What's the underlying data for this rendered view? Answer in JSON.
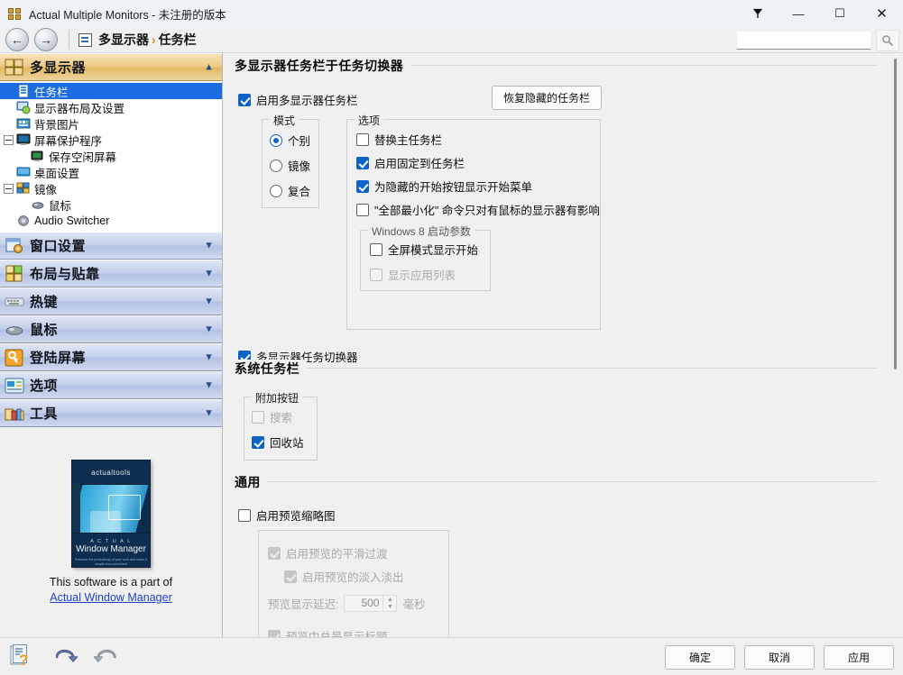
{
  "window": {
    "title": "Actual Multiple Monitors - 未注册的版本",
    "icon": "app-grid-icon",
    "pin_label": "📌",
    "minimize_label": "—",
    "maximize_label": "☐",
    "close_label": "✕"
  },
  "navbar": {
    "back_label": "←",
    "forward_label": "→",
    "breadcrumb_root": "多显示器",
    "breadcrumb_sep": "›",
    "breadcrumb_current": "任务栏",
    "search_value": "",
    "search_placeholder": "",
    "search_button_icon": "magnifier-icon"
  },
  "sidebar": {
    "sections": [
      {
        "label": "多显示器",
        "state": "expanded",
        "chevron": "chevron-up-icon",
        "items": [
          {
            "label": "任务栏",
            "selected": true,
            "expander": "none",
            "indent": 18,
            "icon": "taskbar-icon"
          },
          {
            "label": "显示器布局及设置",
            "selected": false,
            "expander": "none",
            "indent": 18,
            "icon": "monitor-layout-icon"
          },
          {
            "label": "背景图片",
            "selected": false,
            "expander": "none",
            "indent": 18,
            "icon": "wallpaper-icon"
          },
          {
            "label": "屏幕保护程序",
            "selected": false,
            "expander": "minus",
            "indent": 4,
            "icon": "screensaver-icon"
          },
          {
            "label": "保存空闲屏幕",
            "selected": false,
            "expander": "none",
            "indent": 34,
            "icon": "idle-screen-icon"
          },
          {
            "label": "桌面设置",
            "selected": false,
            "expander": "none",
            "indent": 18,
            "icon": "desktop-icon"
          },
          {
            "label": "镜像",
            "selected": false,
            "expander": "minus",
            "indent": 4,
            "icon": "mirror-icon"
          },
          {
            "label": "鼠标",
            "selected": false,
            "expander": "none",
            "indent": 34,
            "icon": "mouse-icon"
          },
          {
            "label": "Audio Switcher",
            "selected": false,
            "expander": "none",
            "indent": 18,
            "icon": "speaker-icon"
          }
        ]
      },
      {
        "label": "窗口设置",
        "state": "collapsed",
        "chevron": "chevron-down-icon",
        "icon": "window-settings-icon"
      },
      {
        "label": "布局与贴靠",
        "state": "collapsed",
        "chevron": "chevron-down-icon",
        "icon": "layout-snap-icon"
      },
      {
        "label": "热键",
        "state": "collapsed",
        "chevron": "chevron-down-icon",
        "icon": "keyboard-icon"
      },
      {
        "label": "鼠标",
        "state": "collapsed",
        "chevron": "chevron-down-icon",
        "icon": "mouse-icon"
      },
      {
        "label": "登陆屏幕",
        "state": "collapsed",
        "chevron": "chevron-down-icon",
        "icon": "key-icon"
      },
      {
        "label": "选项",
        "state": "collapsed",
        "chevron": "chevron-down-icon",
        "icon": "options-icon"
      },
      {
        "label": "工具",
        "state": "collapsed",
        "chevron": "chevron-down-icon",
        "icon": "tools-icon"
      }
    ],
    "promo": {
      "box_top_text": "actualtools",
      "box_brand_small": "A C T U A L",
      "box_brand": "Window Manager",
      "box_tagline": "Enhance the productivity of your work and make it\nsimple and convenient",
      "spine_text": "Window Manager",
      "caption": "This software is a part of",
      "link": "Actual Window Manager"
    }
  },
  "main": {
    "section1": {
      "title": "多显示器任务栏于任务切换器",
      "enable_taskbar": {
        "label": "启用多显示器任务栏",
        "checked": true
      },
      "restore_button": "恢复隐藏的任务栏",
      "mode_group": {
        "title": "模式",
        "options": [
          {
            "label": "个别",
            "selected": true
          },
          {
            "label": "镜像",
            "selected": false
          },
          {
            "label": "复合",
            "selected": false
          }
        ]
      },
      "options_group": {
        "title": "选项",
        "items": [
          {
            "label": "替换主任务栏",
            "checked": false,
            "disabled": false
          },
          {
            "label": "启用固定到任务栏",
            "checked": true,
            "disabled": false
          },
          {
            "label": "为隐藏的开始按钮显示开始菜单",
            "checked": true,
            "disabled": false
          },
          {
            "label": "\"全部最小化\" 命令只对有鼠标的显示器有影响",
            "checked": false,
            "disabled": false
          }
        ],
        "win8_group": {
          "title": "Windows 8 启动参数",
          "items": [
            {
              "label": "全屏模式显示开始",
              "checked": false,
              "disabled": false
            },
            {
              "label": "显示应用列表",
              "checked": false,
              "disabled": true
            }
          ]
        }
      },
      "task_switcher": {
        "label": "多显示器任务切换器",
        "checked": true
      }
    },
    "section2": {
      "title": "系统任务栏",
      "extra_buttons_group": {
        "title": "附加按钮",
        "items": [
          {
            "label": "搜索",
            "checked": false,
            "disabled": true
          },
          {
            "label": "回收站",
            "checked": true,
            "disabled": false
          }
        ]
      }
    },
    "section3": {
      "title": "通用",
      "enable_preview": {
        "label": "启用预览缩略图",
        "checked": false,
        "disabled": false
      },
      "sub_items": [
        {
          "label": "启用预览的平滑过渡",
          "checked": true,
          "disabled": true,
          "indent": 0
        },
        {
          "label": "启用预览的淡入淡出",
          "checked": true,
          "disabled": true,
          "indent": 18
        }
      ],
      "delay": {
        "label": "预览显示延迟:",
        "value": "500",
        "unit": "毫秒",
        "up_arrow": "▲",
        "down_arrow": "▼"
      },
      "always_show_title": {
        "label": "预览中总是显示标题",
        "checked": true,
        "disabled": true
      }
    }
  },
  "bottombar": {
    "help_icon": "help-document-icon",
    "undo_icon": "undo-arrow-icon",
    "redo_icon": "redo-arrow-icon",
    "ok_label": "确定",
    "cancel_label": "取消",
    "apply_label": "应用"
  }
}
